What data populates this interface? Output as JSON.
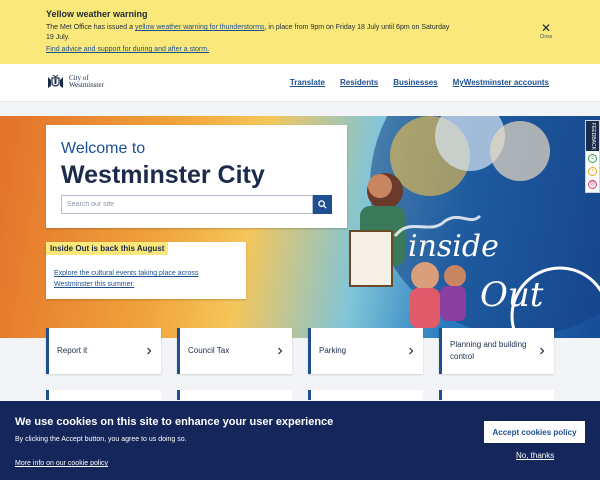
{
  "alert": {
    "title": "Yellow weather warning",
    "text_before": "The Met Office has issued a ",
    "link_text": "yellow weather warning for thunderstorms",
    "text_after": ", in place from 9pm on Friday 18 July until 6pm on Saturday 19 July.",
    "advice_link": "Find advice and support for during and after a storm.",
    "close_label": "Close"
  },
  "header": {
    "logo_line1": "City of",
    "logo_line2": "Westminster",
    "nav": [
      "Translate",
      "Residents",
      "Businesses",
      "MyWestminster accounts"
    ]
  },
  "hero": {
    "welcome_line1": "Welcome to",
    "welcome_line2": "Westminster City Council",
    "search_placeholder": "Search our site",
    "promo_tag": "Inside Out is back this August",
    "promo_link": "Explore the cultural events taking place across Westminster this summer.",
    "art_word1": "inside",
    "art_word2": "Out"
  },
  "feedback": {
    "label": "FEEDBACK"
  },
  "tiles": [
    "Report it",
    "Council Tax",
    "Parking",
    "Planning and building control"
  ],
  "cookie": {
    "title": "We use cookies on this site to enhance your user experience",
    "text": "By clicking the Accept button, you agree to us doing so.",
    "more_link": "More info on our cookie policy",
    "accept_label": "Accept cookies policy",
    "decline_label": "No, thanks"
  },
  "colors": {
    "brand_navy": "#14265a",
    "link_blue": "#1d4f91",
    "warning_yellow": "#fbe87a"
  }
}
